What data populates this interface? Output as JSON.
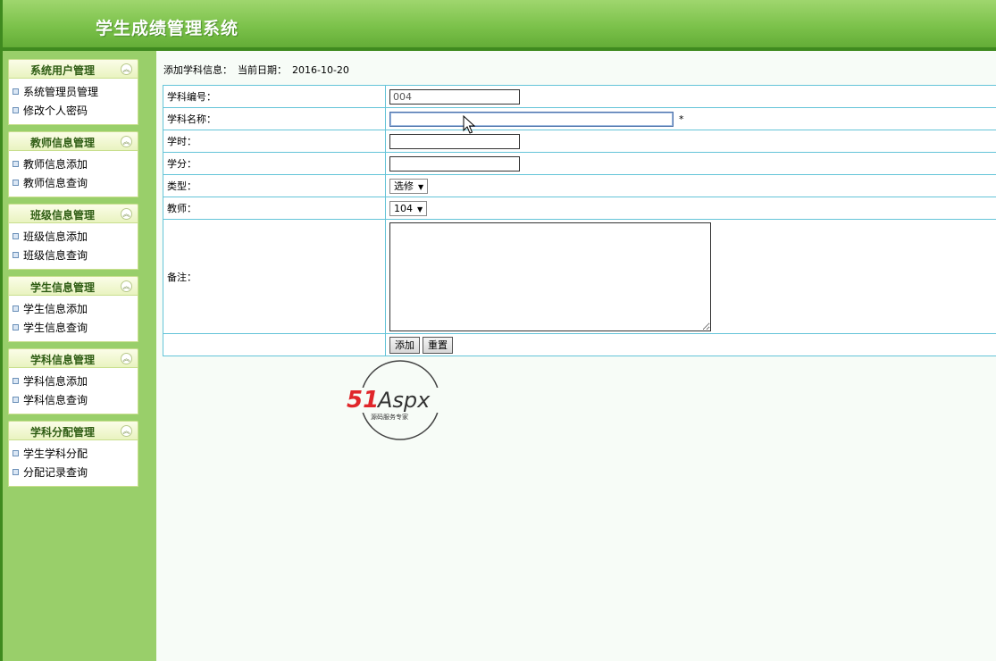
{
  "app": {
    "title": "学生成绩管理系统"
  },
  "sidebar": {
    "groups": [
      {
        "title": "系统用户管理",
        "items": [
          "系统管理员管理",
          "修改个人密码"
        ]
      },
      {
        "title": "教师信息管理",
        "items": [
          "教师信息添加",
          "教师信息查询"
        ]
      },
      {
        "title": "班级信息管理",
        "items": [
          "班级信息添加",
          "班级信息查询"
        ]
      },
      {
        "title": "学生信息管理",
        "items": [
          "学生信息添加",
          "学生信息查询"
        ]
      },
      {
        "title": "学科信息管理",
        "items": [
          "学科信息添加",
          "学科信息查询"
        ]
      },
      {
        "title": "学科分配管理",
        "items": [
          "学生学科分配",
          "分配记录查询"
        ]
      }
    ],
    "collapse_icon": "chevron-double-up-icon"
  },
  "page": {
    "heading": "添加学科信息：",
    "date_label": "当前日期：",
    "date_value": "2016-10-20"
  },
  "form": {
    "code_label": "学科编号：",
    "code_value": "004",
    "name_label": "学科名称：",
    "name_value": "",
    "name_required": "*",
    "hours_label": "学时：",
    "hours_value": "",
    "credit_label": "学分：",
    "credit_value": "",
    "type_label": "类型：",
    "type_value": "选修",
    "teacher_label": "教师：",
    "teacher_value": "104",
    "remarks_label": "备注：",
    "remarks_value": "",
    "add_button": "添加",
    "reset_button": "重置"
  },
  "watermark": {
    "brand_51": "51",
    "brand_aspx": "Aspx",
    "tagline": "源码服务专家"
  },
  "colors": {
    "header_green": "#7cc24b",
    "sidebar_green": "#99cf6a",
    "table_border": "#64c4d8",
    "brand_red": "#e0262a",
    "brand_green": "#5fae2e"
  }
}
